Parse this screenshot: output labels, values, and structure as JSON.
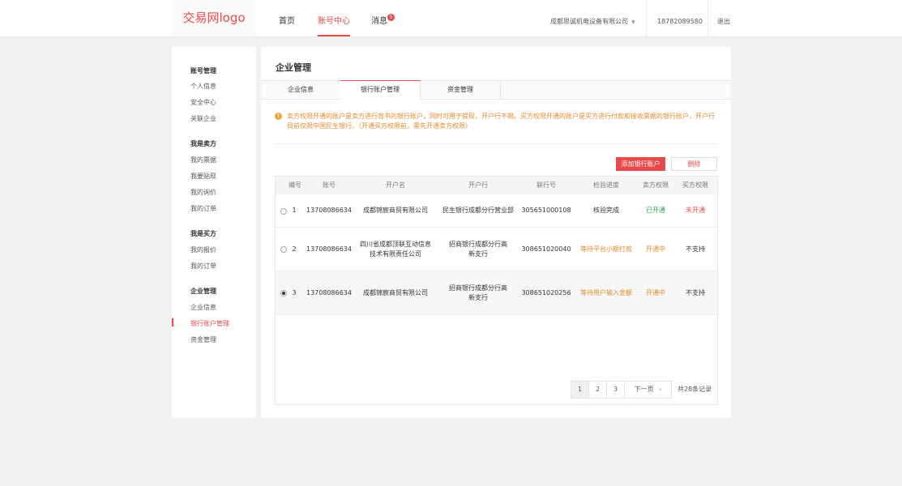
{
  "header": {
    "logo": "交易网logo",
    "nav": [
      {
        "label": "首页"
      },
      {
        "label": "账号中心"
      },
      {
        "label": "消息"
      }
    ],
    "message_badge": "5",
    "company": "成都思诚机电设备有限公司",
    "phone": "18782089580",
    "logout": "退出"
  },
  "sidebar": {
    "groups": [
      {
        "title": "账号管理",
        "items": [
          "个人信息",
          "安全中心",
          "关联企业"
        ]
      },
      {
        "title": "我是卖方",
        "items": [
          "我的票据",
          "我要贴现",
          "我的询价",
          "我的订单"
        ]
      },
      {
        "title": "我是买方",
        "items": [
          "我的报价",
          "我的订单"
        ]
      },
      {
        "title": "企业管理",
        "items": [
          "企业信息",
          "银行账户管理",
          "资金管理"
        ]
      }
    ]
  },
  "main": {
    "title": "企业管理",
    "tabs": [
      "企业信息",
      "银行账户管理",
      "资金管理"
    ],
    "notice": "卖方权限开通的账户是卖方进行背书的银行账户，同时可用于提现，开户行不限。买方权限开通的账户是买方进行付款和接收票据的银行账户，开户行目前仅限中国民生银行。（开通买方权限前，需先开通卖方权限）",
    "add_button": "添加银行账户",
    "delete_button": "删除",
    "columns": [
      "编号",
      "账号",
      "开户名",
      "开户行",
      "联行号",
      "检验进度",
      "卖方权限",
      "买方权限"
    ],
    "rows": [
      {
        "no": "1",
        "account": "13708086634",
        "name": "成都锦宸商贸有限公司",
        "bank": "民生银行成都分行营业部",
        "code": "305651000108",
        "progress": "核验完成",
        "sell": "已开通",
        "buy": "未开通"
      },
      {
        "no": "2",
        "account": "13708086634",
        "name": "四川省成都顶联互动信息技术有限责任公司",
        "bank": "招商银行成都分行高新支行",
        "code": "308651020040",
        "progress": "等待平台小额打款",
        "sell": "开通中",
        "buy": "不支持"
      },
      {
        "no": "3",
        "account": "13708086634",
        "name": "成都锦宸商贸有限公司",
        "bank": "招商银行成都分行高新支行",
        "code": "308651020256",
        "progress": "等待用户输入金额",
        "sell": "开通中",
        "buy": "不支持"
      }
    ],
    "pagination": {
      "pages": [
        "1",
        "2",
        "3"
      ],
      "next": "下一页",
      "total": "共28条记录"
    }
  },
  "colors": {
    "accent": "#e84a4a",
    "success": "#2aa34a",
    "warning": "#e0892a"
  }
}
